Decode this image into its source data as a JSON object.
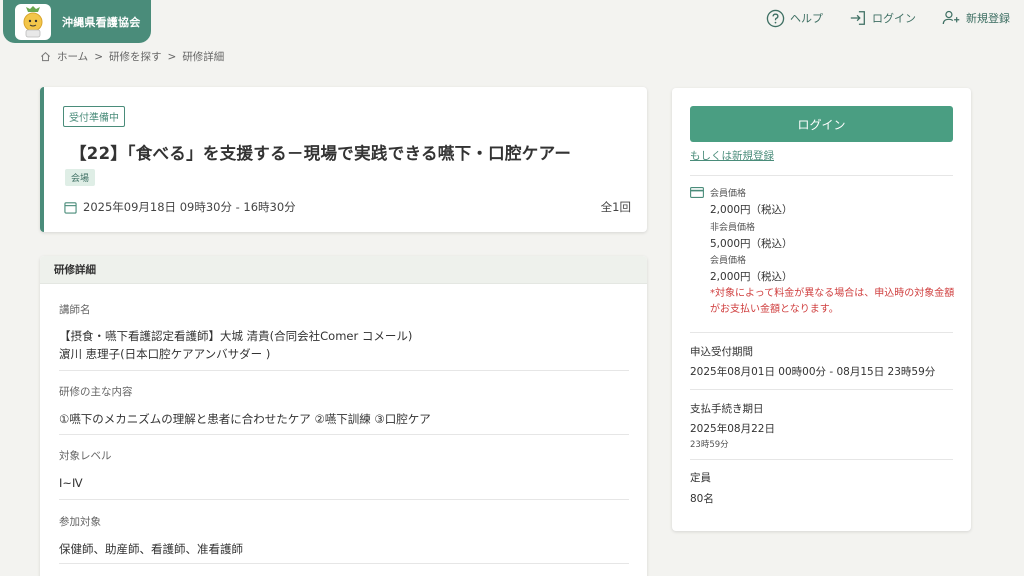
{
  "header": {
    "org_name": "沖縄県看護協会",
    "nav": {
      "help": "ヘルプ",
      "login": "ログイン",
      "register": "新規登録"
    }
  },
  "breadcrumb": {
    "home": "ホーム",
    "search": "研修を探す",
    "current": "研修詳細"
  },
  "course": {
    "status": "受付準備中",
    "title": "【22】「食べる」を支援する－現場で実践できる嚥下・口腔ケアー",
    "venue": "会場",
    "date": "2025年09月18日 09時30分 - 16時30分",
    "count": "全1回"
  },
  "details": {
    "header": "研修詳細",
    "instructor_label": "講師名",
    "instructor_line1": "【摂食・嚥下看護認定看護師】大城 清貴(合同会社Comer コメール)",
    "instructor_line2": "濵川 恵理子(日本口腔ケアアンバサダー )",
    "content_label": "研修の主な内容",
    "content_value": "①嚥下のメカニズムの理解と患者に合わせたケア ②嚥下訓練 ③口腔ケア",
    "level_label": "対象レベル",
    "level_value": "Ⅰ~Ⅳ",
    "target_label": "参加対象",
    "target_value": "保健師、助産師、看護師、准看護師"
  },
  "sidebar": {
    "login_button": "ログイン",
    "register_link": "もしくは新規登録",
    "prices": [
      {
        "label": "会員価格",
        "value": "2,000円（税込）"
      },
      {
        "label": "非会員価格",
        "value": "5,000円（税込）"
      },
      {
        "label": "会員価格",
        "value": "2,000円（税込）"
      }
    ],
    "price_note": "*対象によって料金が異なる場合は、申込時の対象金額がお支払い金額となります。",
    "application_period_label": "申込受付期間",
    "application_period_value": "2025年08月01日 00時00分 - 08月15日 23時59分",
    "payment_deadline_label": "支払手続き期日",
    "payment_deadline_date": "2025年08月22日",
    "payment_deadline_time": "23時59分",
    "capacity_label": "定員",
    "capacity_value": "80名"
  },
  "colors": {
    "brand": "#4a8c7a",
    "button": "#4a9e82",
    "warning": "#d04040"
  }
}
